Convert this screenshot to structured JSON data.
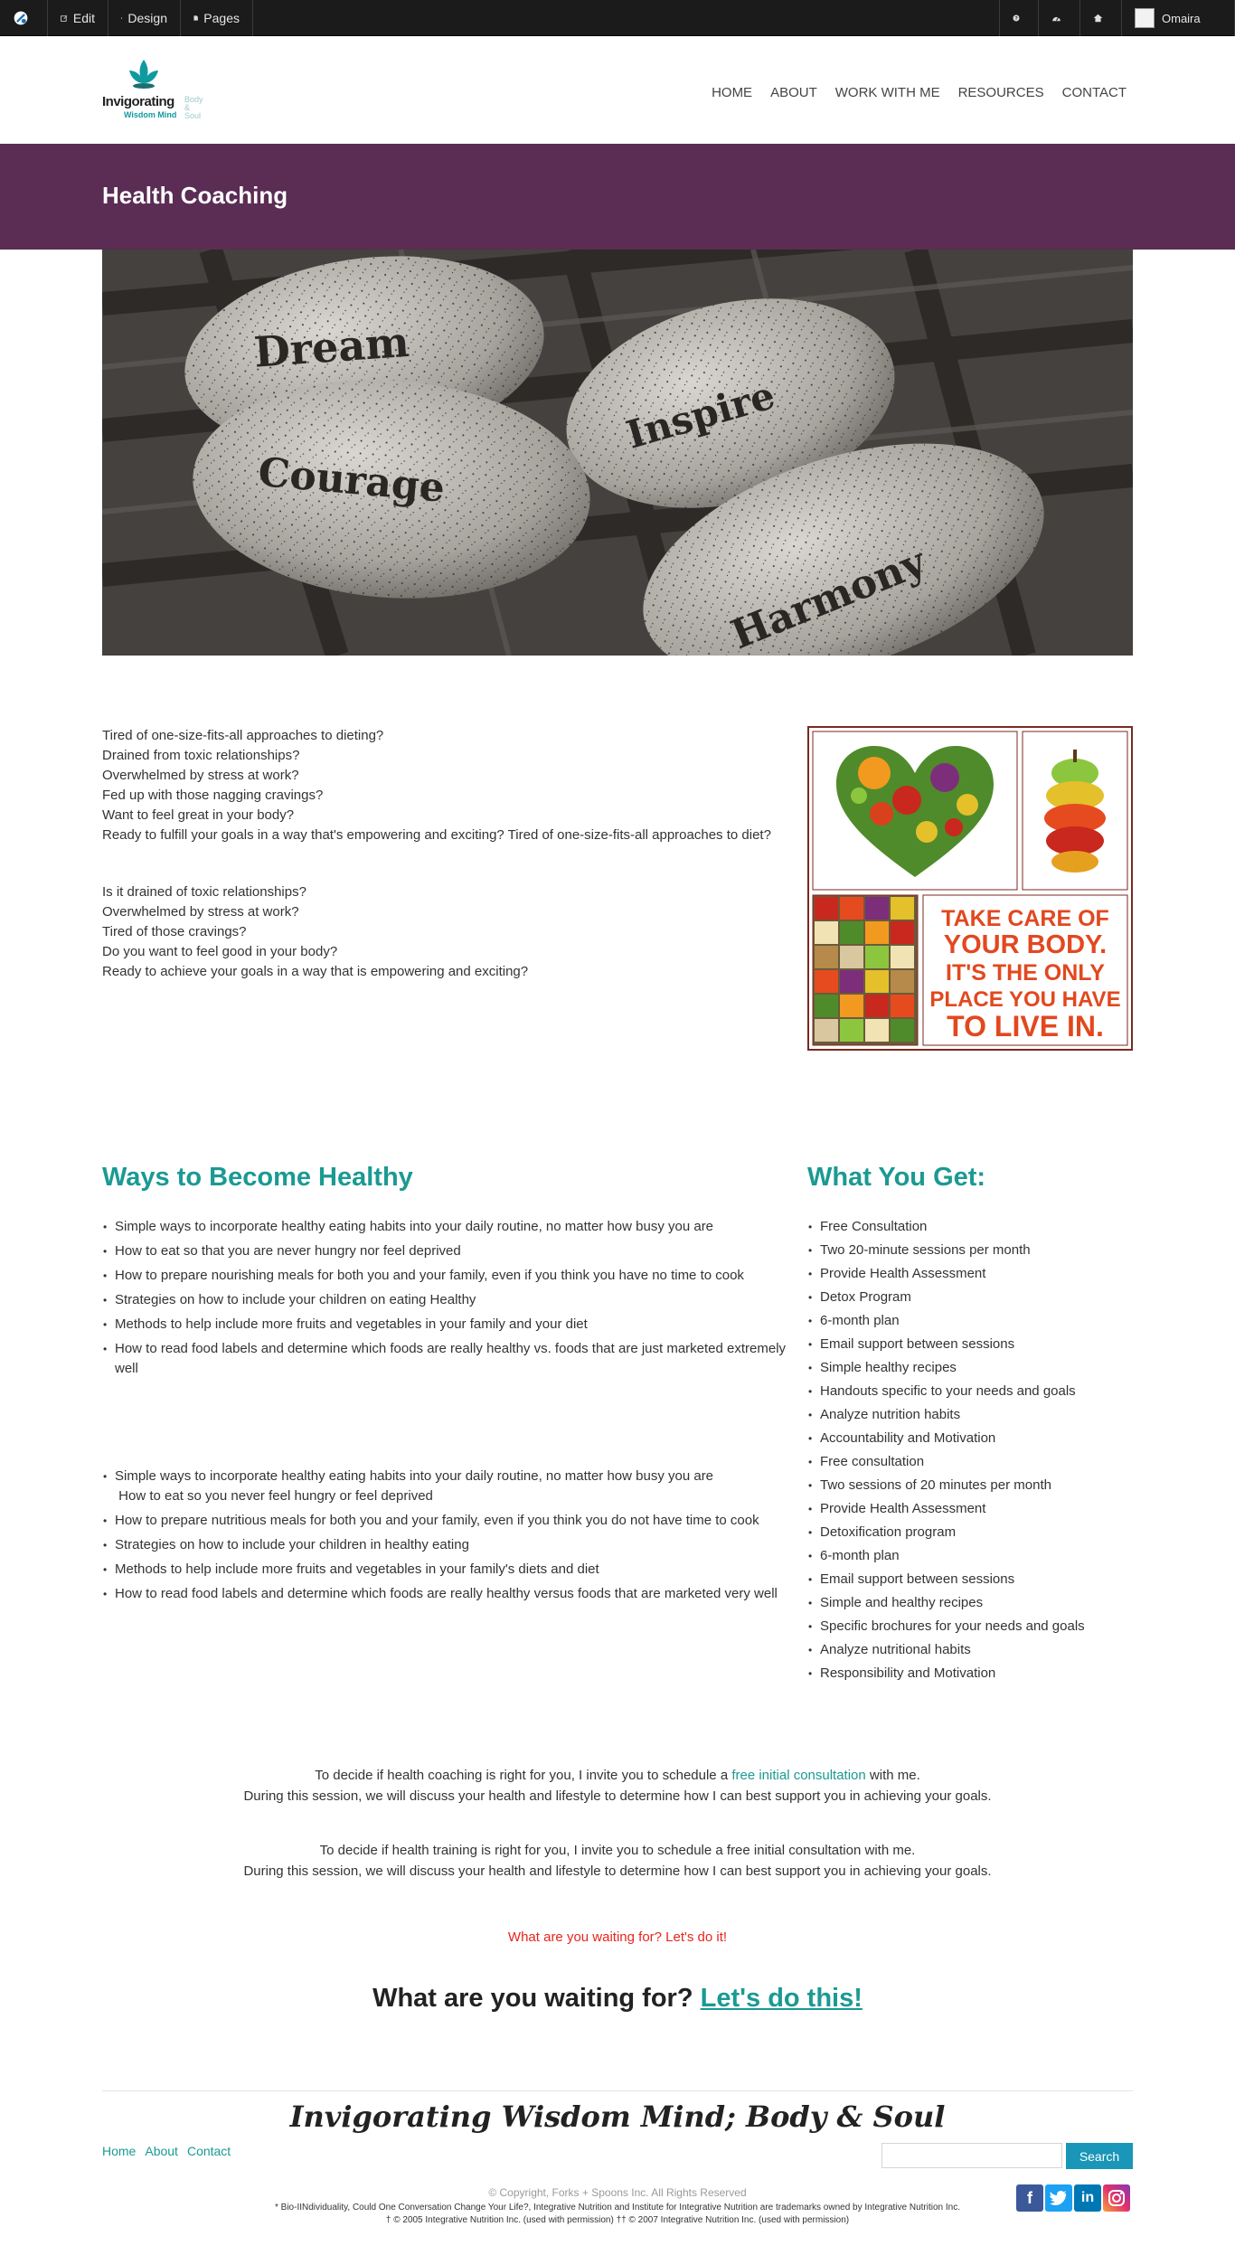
{
  "admin_bar": {
    "edit": "Edit",
    "design": "Design",
    "pages": "Pages",
    "user": "Omaira"
  },
  "header": {
    "logo_brand": "Invigorating",
    "logo_sub": "Wisdom Mind",
    "logo_side_1": "Body",
    "logo_side_2": "&",
    "logo_side_3": "Soul",
    "nav": [
      "HOME",
      "ABOUT",
      "WORK WITH ME",
      "RESOURCES",
      "CONTACT"
    ]
  },
  "banner": {
    "title": "Health Coaching"
  },
  "hero": {
    "words": [
      "Dream",
      "Inspire",
      "Courage",
      "Harmony"
    ]
  },
  "intro": {
    "block1": [
      "Tired of one-size-fits-all approaches to dieting?",
      "Drained from toxic relationships?",
      "Overwhelmed by stress at work?",
      "Fed up with those nagging cravings?",
      "Want to feel great in your body?",
      "Ready to fulfill your goals in a way that's empowering and exciting? Tired of one-size-fits-all approaches to diet?"
    ],
    "block2": [
      "Is it drained of toxic relationships?",
      "Overwhelmed by stress at work?",
      "Tired of those cravings?",
      "Do you want to feel good in your body?",
      "Ready to achieve your goals in a way that is empowering and exciting?"
    ]
  },
  "poster": {
    "line1": "TAKE CARE OF",
    "line2": "YOUR BODY.",
    "line3": "IT'S THE ONLY",
    "line4": "PLACE YOU HAVE",
    "line5": "TO LIVE IN."
  },
  "ways": {
    "title": "Ways to Become Healthy",
    "list1": [
      "Simple ways to incorporate healthy eating habits into your daily routine, no matter how busy you are",
      "How to eat so that you are never hungry nor feel deprived",
      "How to prepare nourishing meals for both you and your family, even if you think you have no time to cook",
      "Strategies on how to include your children on  eating Healthy",
      "Methods to help include more fruits and vegetables in your family and your diet",
      "How to read food labels and determine which foods are really healthy vs. foods that are just marketed extremely well"
    ],
    "list2": [
      "Simple ways to incorporate healthy eating habits into your daily routine, no matter how busy you are",
      "How to prepare nutritious meals for both you and your family, even if you think you do not have time to cook",
      "Strategies on how to include your children in healthy eating",
      "Methods to help include more fruits and vegetables in your family's diets and diet",
      "How to read food labels and determine which foods are really healthy versus foods that are marketed very well"
    ],
    "list2_first_cont": "How to eat so you never feel hungry or feel deprived"
  },
  "get": {
    "title": "What You Get:",
    "items": [
      "Free Consultation",
      "Two 20-minute sessions per month",
      "Provide Health Assessment",
      "Detox Program",
      "6-month plan",
      "Email support between sessions",
      "Simple healthy recipes",
      "Handouts specific to your needs and goals",
      "Analyze nutrition habits",
      "Accountability and Motivation",
      "Free consultation",
      "Two sessions of 20 minutes per month",
      "Provide Health Assessment",
      "Detoxification program",
      "6-month plan",
      "Email support between sessions",
      "Simple and healthy recipes",
      "Specific brochures for your needs and goals",
      "Analyze nutritional habits",
      "Responsibility and Motivation"
    ]
  },
  "cta": {
    "p1_pre": "To decide if health coaching is right for you, I invite you to schedule a ",
    "p1_link": "free initial consultation",
    "p1_post": "  with me.",
    "p1_line2": "During this session, we will discuss your health and lifestyle to determine how I can best support you in achieving your goals.",
    "p2_line1": "To decide if health training is right for you, I invite you to schedule a free initial consultation with me.",
    "p2_line2": "During this session, we will discuss your health and lifestyle to determine how I can best support you in achieving your goals.",
    "red": "What are you waiting for? Let's do it!",
    "big_pre": "What are you waiting for? ",
    "big_link": "Let's do this! "
  },
  "footer": {
    "title": "Invigorating Wisdom Mind; Body & Soul",
    "links": [
      "Home",
      "About",
      "Contact"
    ],
    "search_placeholder": "",
    "search_button": "Search",
    "copyright": "© Copyright, Forks + Spoons Inc. All Rights Reserved",
    "tm_line1": "* Bio-IINdividuality, Could One Conversation Change Your Life?, Integrative Nutrition and Institute for Integrative Nutrition are trademarks owned by Integrative Nutrition Inc.",
    "tm_line2": "† © 2005 Integrative Nutrition Inc. (used with permission) †† © 2007 Integrative Nutrition Inc. (used with permission)"
  },
  "colors": {
    "banner": "#5b2c54",
    "accent": "#1a9a92",
    "cta_red": "#e8241c",
    "search_button": "#1996b8"
  }
}
